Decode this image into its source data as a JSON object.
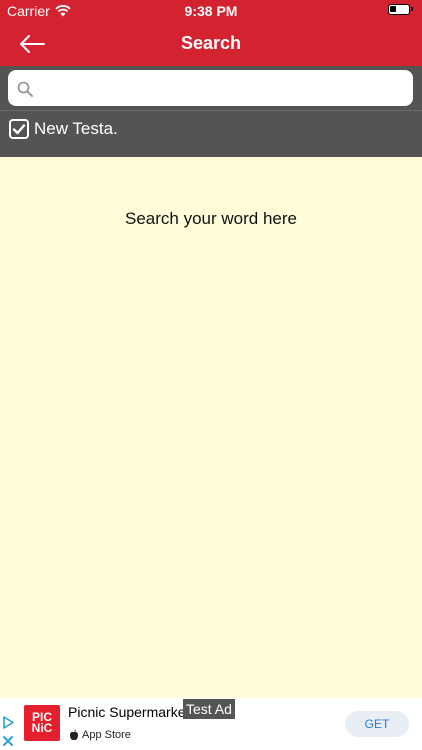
{
  "status_bar": {
    "carrier": "Carrier",
    "time": "9:38 PM"
  },
  "nav": {
    "title": "Search"
  },
  "search": {
    "placeholder": "",
    "value": ""
  },
  "filter": {
    "label": "New Testa.",
    "checked": true
  },
  "content": {
    "hint": "Search your word here"
  },
  "ad": {
    "logo_line1": "PIC",
    "logo_line2": "NiC",
    "app_name": "Picnic Supermarket",
    "store_label": "App Store",
    "badge": "Test Ad",
    "cta": "GET"
  },
  "colors": {
    "primary": "#d32330",
    "toolbar": "#545454",
    "background": "#fffcd9"
  }
}
